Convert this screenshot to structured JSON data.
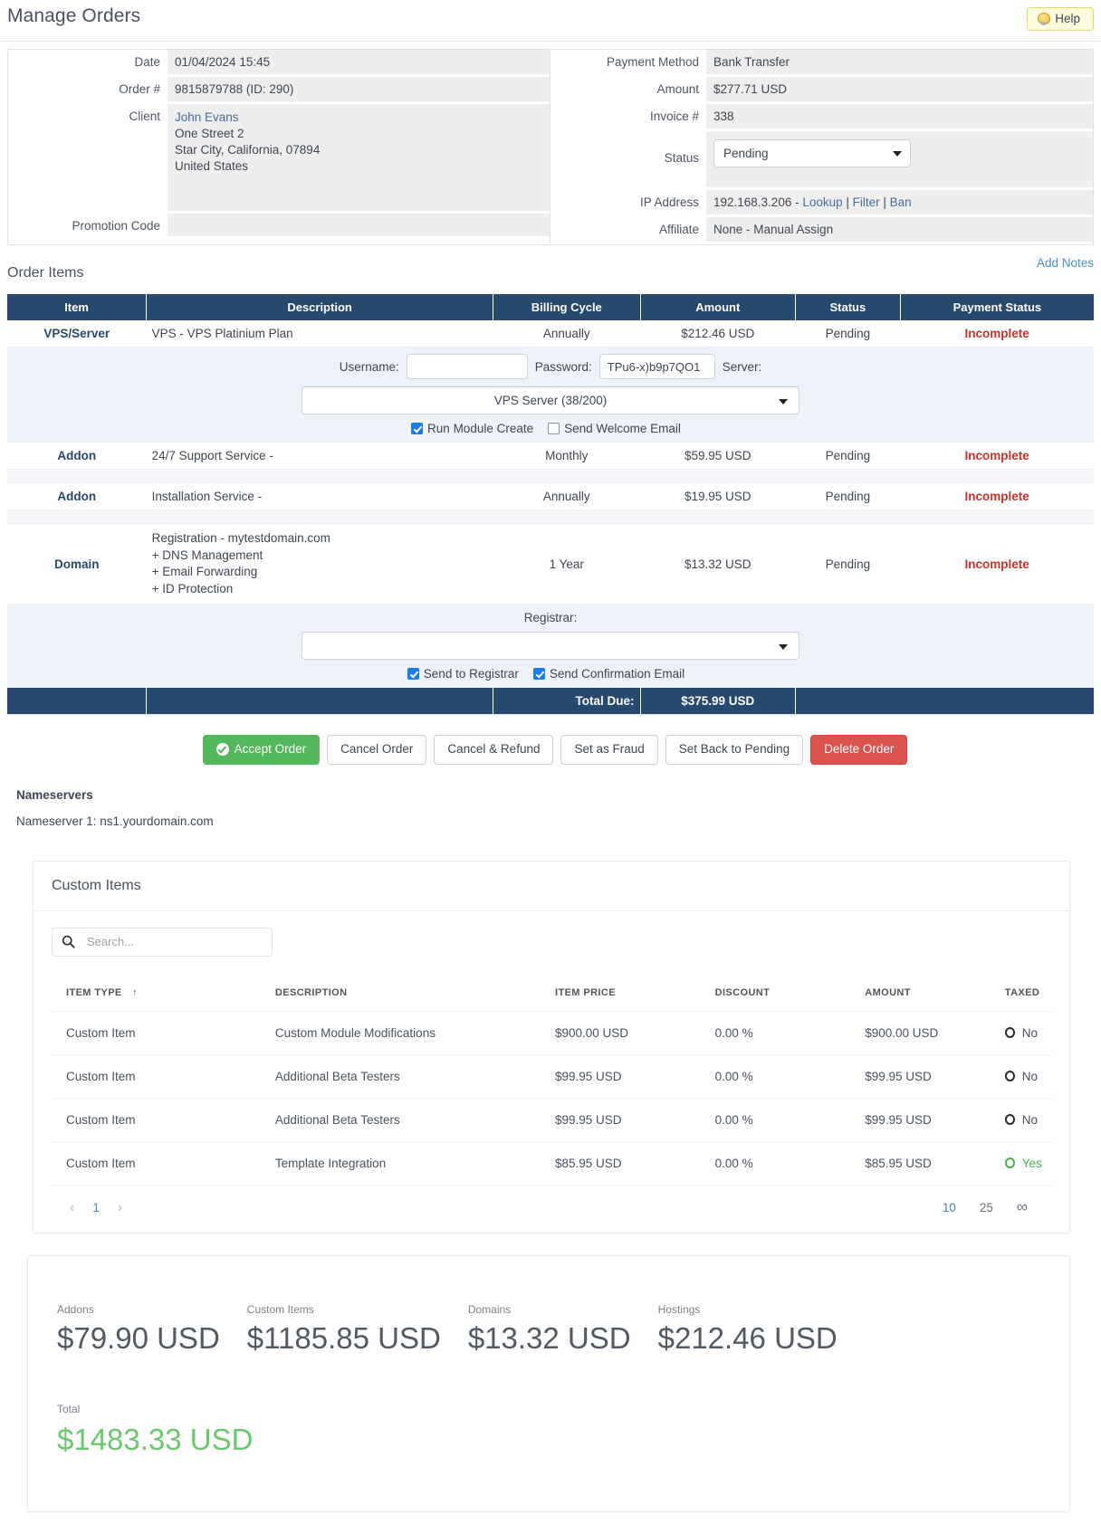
{
  "page": {
    "title": "Manage Orders",
    "help_label": "Help"
  },
  "order_info": {
    "left": [
      {
        "label": "Date",
        "value": "01/04/2024 15:45"
      },
      {
        "label": "Order #",
        "value": "9815879788 (ID: 290)"
      },
      {
        "label": "Client",
        "value_link": "John Evans",
        "address": [
          "One Street 2",
          "Star City, California, 07894",
          "United States"
        ]
      },
      {
        "label": "Promotion Code",
        "value": ""
      }
    ],
    "right": {
      "payment_method_label": "Payment Method",
      "payment_method": "Bank Transfer",
      "amount_label": "Amount",
      "amount": "$277.71 USD",
      "invoice_label": "Invoice #",
      "invoice": "338",
      "status_label": "Status",
      "status_value": "Pending",
      "ip_label": "IP Address",
      "ip_value": "192.168.3.206 - ",
      "ip_lookup": "Lookup",
      "ip_filter": "Filter",
      "ip_ban": "Ban",
      "affiliate_label": "Affiliate",
      "affiliate": "None - Manual Assign"
    }
  },
  "order_items": {
    "section_title": "Order Items",
    "add_notes": "Add Notes",
    "columns": [
      "Item",
      "Description",
      "Billing Cycle",
      "Amount",
      "Status",
      "Payment Status"
    ],
    "rows": [
      {
        "item": "VPS/Server",
        "description": "VPS - VPS Platinium Plan",
        "cycle": "Annually",
        "amount": "$212.46 USD",
        "status": "Pending",
        "payment_status": "Incomplete"
      },
      {
        "item": "Addon",
        "description": "24/7 Support Service -",
        "cycle": "Monthly",
        "amount": "$59.95 USD",
        "status": "Pending",
        "payment_status": "Incomplete"
      },
      {
        "item": "Addon",
        "description": "Installation Service -",
        "cycle": "Annually",
        "amount": "$19.95 USD",
        "status": "Pending",
        "payment_status": "Incomplete"
      },
      {
        "item": "Domain",
        "description_lines": [
          "Registration - mytestdomain.com",
          "+ DNS Management",
          "+ Email Forwarding",
          "+ ID Protection"
        ],
        "cycle": "1 Year",
        "amount": "$13.32 USD",
        "status": "Pending",
        "payment_status": "Incomplete"
      }
    ],
    "vps_panel": {
      "username_label": "Username:",
      "username_value": "",
      "password_label": "Password:",
      "password_value": "TPu6-x)b9p7QO1",
      "server_label": "Server:",
      "server_select": "VPS Server (38/200)",
      "run_module_create": "Run Module Create",
      "send_welcome_email": "Send Welcome Email"
    },
    "domain_panel": {
      "registrar_label": "Registrar:",
      "registrar_select": "",
      "send_to_registrar": "Send to Registrar",
      "send_confirmation_email": "Send Confirmation Email"
    },
    "total_due_label": "Total Due:",
    "total_due_value": "$375.99 USD"
  },
  "actions": [
    {
      "label": "Accept Order",
      "style": "green"
    },
    {
      "label": "Cancel Order",
      "style": "default"
    },
    {
      "label": "Cancel & Refund",
      "style": "default"
    },
    {
      "label": "Set as Fraud",
      "style": "default"
    },
    {
      "label": "Set Back to Pending",
      "style": "default"
    },
    {
      "label": "Delete Order",
      "style": "red"
    }
  ],
  "nameservers": {
    "title": "Nameservers",
    "lines": [
      "Nameserver 1: ns1.yourdomain.com"
    ]
  },
  "custom_items": {
    "title": "Custom Items",
    "search_placeholder": "Search...",
    "search_value": "",
    "columns": [
      "ITEM TYPE",
      "DESCRIPTION",
      "ITEM PRICE",
      "DISCOUNT",
      "AMOUNT",
      "TAXED"
    ],
    "sort_column": "ITEM TYPE",
    "sort_arrow": "↑",
    "rows": [
      {
        "type": "Custom Item",
        "description": "Custom Module Modifications",
        "price": "$900.00 USD",
        "discount": "0.00 %",
        "amount": "$900.00 USD",
        "taxed": "No"
      },
      {
        "type": "Custom Item",
        "description": "Additional Beta Testers",
        "price": "$99.95 USD",
        "discount": "0.00 %",
        "amount": "$99.95 USD",
        "taxed": "No"
      },
      {
        "type": "Custom Item",
        "description": "Additional Beta Testers",
        "price": "$99.95 USD",
        "discount": "0.00 %",
        "amount": "$99.95 USD",
        "taxed": "No"
      },
      {
        "type": "Custom Item",
        "description": "Template Integration",
        "price": "$85.95 USD",
        "discount": "0.00 %",
        "amount": "$85.95 USD",
        "taxed": "Yes"
      }
    ],
    "pagination": {
      "prev": "‹",
      "page": "1",
      "next": "›",
      "sizes": [
        "10",
        "25",
        "∞"
      ],
      "active_size": "10"
    }
  },
  "summary": {
    "cards": [
      {
        "label": "Addons",
        "value": "$79.90 USD"
      },
      {
        "label": "Custom Items",
        "value": "$1185.85 USD"
      },
      {
        "label": "Domains",
        "value": "$13.32 USD"
      },
      {
        "label": "Hostings",
        "value": "$212.46 USD"
      }
    ],
    "total_label": "Total",
    "total_value": "$1483.33 USD"
  },
  "colors": {
    "header_blue": "#27496d",
    "accent_green": "#53b85b",
    "danger_red": "#c9302c",
    "link_blue": "#4a90c4",
    "total_green": "#6ac96f"
  }
}
